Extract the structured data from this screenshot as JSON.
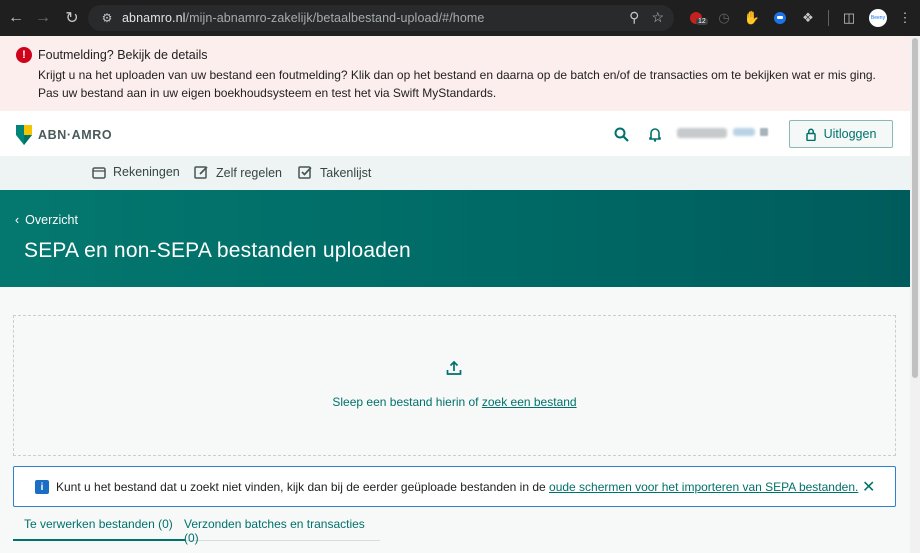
{
  "browser": {
    "url_host": "abnamro.nl",
    "url_path": "/mijn-abnamro-zakelijk/betaalbestand-upload/#/home",
    "extension_badge": "12",
    "profile_label": "Beeny"
  },
  "error_banner": {
    "title": "Foutmelding? Bekijk de details",
    "text": "Krijgt u na het uploaden van uw bestand een foutmelding? Klik dan op het bestand en daarna op de batch en/of de transacties om te bekijken wat er mis ging. Pas uw bestand aan in uw eigen boekhoudsysteem en test het via Swift MyStandards."
  },
  "header": {
    "brand": "ABN·AMRO",
    "logout_label": "Uitloggen"
  },
  "nav": {
    "items": [
      {
        "label": "Rekeningen",
        "icon": "wallet-icon"
      },
      {
        "label": "Zelf regelen",
        "icon": "edit-icon"
      },
      {
        "label": "Takenlijst",
        "icon": "checklist-icon"
      }
    ]
  },
  "hero": {
    "back_label": "Overzicht",
    "title": "SEPA en non-SEPA bestanden uploaden"
  },
  "dropzone": {
    "text": "Sleep een bestand hierin of ",
    "link": "zoek een bestand"
  },
  "info": {
    "text": "Kunt u het bestand dat u zoekt niet vinden, kijk dan bij de eerder geüploade bestanden in de ",
    "link": "oude schermen voor het importeren van SEPA bestanden."
  },
  "tabs": [
    {
      "label": "Te verwerken bestanden (0)",
      "active": true
    },
    {
      "label": "Verzonden batches en transacties (0)",
      "active": false
    }
  ],
  "colors": {
    "brand_green": "#00716b",
    "error_red": "#d0021b",
    "info_blue": "#1a6fc4"
  }
}
